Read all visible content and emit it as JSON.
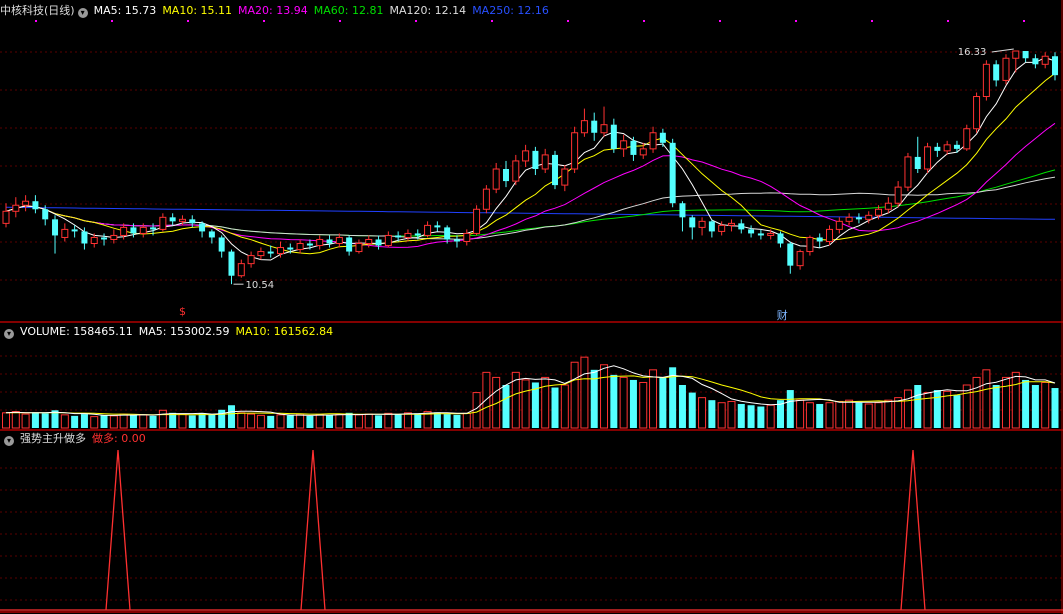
{
  "colors": {
    "up": "#ff3232",
    "down": "#54ffff",
    "ma5": "#ffffff",
    "ma10": "#ffff00",
    "ma20": "#ff00ff",
    "ma60": "#00e000",
    "ma120": "#d8d8d8",
    "ma250": "#2040ff",
    "divider": "#b00000",
    "grid": "#5a0000",
    "signal": "#ff3030",
    "marker": "#ff00ff"
  },
  "main_header": {
    "stock_name": "中核科技(日线)",
    "collapse_icon": "chevron-down-icon",
    "ma5_label": "MA5: 15.73",
    "ma10_label": "MA10: 15.11",
    "ma20_label": "MA20: 13.94",
    "ma60_label": "MA60: 12.81",
    "ma120_label": "MA120: 12.14",
    "ma250_label": "MA250: 12.16"
  },
  "volume_header": {
    "volume_label": "VOLUME: 158465.11",
    "ma5_label": "MA5: 153002.59",
    "ma10_label": "MA10: 161562.84"
  },
  "indicator_header": {
    "name": "强势主升做多",
    "signal_name": "做多",
    "signal_value": ": 0.00"
  },
  "annotations": {
    "high_label": "16.33",
    "low_label": "10.54",
    "mark_s": "$",
    "mark_cai": "财"
  },
  "chart_data": {
    "type": "candlestick",
    "price_range": [
      9.7,
      17.1
    ],
    "candles": [
      [
        12.05,
        12.35,
        12.55,
        11.95
      ],
      [
        12.35,
        12.5,
        12.7,
        12.2
      ],
      [
        12.5,
        12.6,
        12.75,
        12.35
      ],
      [
        12.6,
        12.4,
        12.75,
        12.3
      ],
      [
        12.4,
        12.15,
        12.5,
        12.0
      ],
      [
        12.15,
        11.75,
        12.25,
        11.3
      ],
      [
        11.7,
        11.9,
        12.05,
        11.6
      ],
      [
        11.9,
        11.85,
        12.0,
        11.7
      ],
      [
        11.85,
        11.55,
        11.95,
        11.4
      ],
      [
        11.55,
        11.7,
        11.8,
        11.45
      ],
      [
        11.7,
        11.65,
        11.8,
        11.5
      ],
      [
        11.65,
        11.75,
        11.9,
        11.55
      ],
      [
        11.75,
        11.95,
        12.05,
        11.65
      ],
      [
        11.95,
        11.8,
        12.05,
        11.7
      ],
      [
        11.8,
        11.95,
        12.05,
        11.7
      ],
      [
        11.95,
        11.9,
        12.05,
        11.75
      ],
      [
        11.9,
        12.2,
        12.3,
        11.85
      ],
      [
        12.2,
        12.1,
        12.3,
        12.0
      ],
      [
        12.1,
        12.15,
        12.25,
        12.0
      ],
      [
        12.15,
        12.05,
        12.25,
        11.95
      ],
      [
        12.05,
        11.85,
        12.1,
        11.7
      ],
      [
        11.85,
        11.7,
        11.9,
        11.55
      ],
      [
        11.7,
        11.35,
        11.75,
        11.2
      ],
      [
        11.35,
        10.75,
        11.4,
        10.54
      ],
      [
        10.75,
        11.05,
        11.15,
        10.7
      ],
      [
        11.05,
        11.25,
        11.35,
        10.95
      ],
      [
        11.25,
        11.35,
        11.45,
        11.15
      ],
      [
        11.35,
        11.3,
        11.5,
        11.2
      ],
      [
        11.3,
        11.45,
        11.6,
        11.2
      ],
      [
        11.45,
        11.4,
        11.55,
        11.3
      ],
      [
        11.4,
        11.55,
        11.65,
        11.3
      ],
      [
        11.55,
        11.5,
        11.65,
        11.4
      ],
      [
        11.5,
        11.65,
        11.75,
        11.4
      ],
      [
        11.65,
        11.55,
        11.75,
        11.45
      ],
      [
        11.55,
        11.7,
        11.8,
        11.45
      ],
      [
        11.7,
        11.35,
        11.75,
        11.25
      ],
      [
        11.35,
        11.55,
        11.65,
        11.3
      ],
      [
        11.55,
        11.65,
        11.75,
        11.45
      ],
      [
        11.65,
        11.5,
        11.75,
        11.4
      ],
      [
        11.5,
        11.75,
        11.85,
        11.45
      ],
      [
        11.75,
        11.7,
        11.85,
        11.6
      ],
      [
        11.7,
        11.8,
        11.9,
        11.6
      ],
      [
        11.8,
        11.75,
        11.9,
        11.65
      ],
      [
        11.75,
        12.0,
        12.1,
        11.7
      ],
      [
        12.0,
        11.95,
        12.1,
        11.85
      ],
      [
        11.95,
        11.65,
        12.0,
        11.55
      ],
      [
        11.65,
        11.6,
        11.75,
        11.45
      ],
      [
        11.6,
        11.8,
        11.9,
        11.5
      ],
      [
        11.8,
        12.4,
        12.5,
        11.75
      ],
      [
        12.4,
        12.9,
        13.0,
        12.3
      ],
      [
        12.9,
        13.4,
        13.55,
        12.8
      ],
      [
        13.4,
        13.1,
        13.6,
        12.95
      ],
      [
        13.1,
        13.6,
        13.75,
        13.0
      ],
      [
        13.6,
        13.85,
        14.0,
        13.45
      ],
      [
        13.85,
        13.4,
        13.95,
        13.25
      ],
      [
        13.4,
        13.75,
        13.9,
        13.3
      ],
      [
        13.75,
        13.0,
        13.85,
        12.9
      ],
      [
        13.0,
        13.4,
        13.5,
        12.85
      ],
      [
        13.4,
        14.3,
        14.45,
        13.3
      ],
      [
        14.3,
        14.6,
        14.9,
        14.2
      ],
      [
        14.6,
        14.3,
        14.8,
        14.1
      ],
      [
        14.3,
        14.5,
        14.95,
        14.2
      ],
      [
        14.5,
        13.9,
        14.65,
        13.8
      ],
      [
        13.9,
        14.1,
        14.25,
        13.7
      ],
      [
        14.1,
        13.75,
        14.2,
        13.6
      ],
      [
        13.75,
        13.9,
        14.05,
        13.65
      ],
      [
        13.9,
        14.3,
        14.45,
        13.8
      ],
      [
        14.3,
        14.05,
        14.4,
        13.95
      ],
      [
        14.05,
        12.55,
        14.15,
        12.45
      ],
      [
        12.55,
        12.2,
        12.6,
        11.85
      ],
      [
        12.2,
        11.95,
        12.25,
        11.65
      ],
      [
        11.95,
        12.1,
        12.2,
        11.75
      ],
      [
        12.1,
        11.85,
        12.15,
        11.7
      ],
      [
        11.85,
        12.0,
        12.1,
        11.75
      ],
      [
        12.0,
        12.05,
        12.15,
        11.85
      ],
      [
        12.05,
        11.9,
        12.15,
        11.8
      ],
      [
        11.9,
        11.8,
        12.0,
        11.7
      ],
      [
        11.8,
        11.75,
        11.9,
        11.65
      ],
      [
        11.75,
        11.8,
        11.9,
        11.65
      ],
      [
        11.8,
        11.55,
        11.85,
        11.45
      ],
      [
        11.55,
        11.0,
        11.6,
        10.8
      ],
      [
        11.0,
        11.35,
        11.4,
        10.9
      ],
      [
        11.35,
        11.7,
        11.75,
        11.25
      ],
      [
        11.7,
        11.6,
        11.8,
        11.45
      ],
      [
        11.6,
        11.9,
        12.0,
        11.5
      ],
      [
        11.9,
        12.1,
        12.2,
        11.8
      ],
      [
        12.1,
        12.2,
        12.3,
        12.0
      ],
      [
        12.2,
        12.15,
        12.3,
        12.05
      ],
      [
        12.15,
        12.25,
        12.35,
        12.05
      ],
      [
        12.25,
        12.4,
        12.5,
        12.15
      ],
      [
        12.4,
        12.55,
        12.7,
        12.3
      ],
      [
        12.55,
        12.95,
        13.1,
        12.45
      ],
      [
        12.95,
        13.7,
        13.8,
        12.85
      ],
      [
        13.7,
        13.4,
        14.2,
        13.3
      ],
      [
        13.4,
        13.95,
        14.05,
        13.3
      ],
      [
        13.95,
        13.85,
        14.05,
        13.7
      ],
      [
        13.85,
        14.0,
        14.1,
        13.75
      ],
      [
        14.0,
        13.9,
        14.1,
        13.8
      ],
      [
        13.9,
        14.4,
        14.5,
        13.85
      ],
      [
        14.4,
        15.2,
        15.3,
        14.3
      ],
      [
        15.2,
        16.0,
        16.1,
        15.1
      ],
      [
        16.0,
        15.6,
        16.1,
        15.45
      ],
      [
        15.6,
        16.15,
        16.25,
        15.5
      ],
      [
        16.15,
        16.33,
        16.33,
        15.8
      ],
      [
        16.33,
        16.15,
        16.3,
        16.05
      ],
      [
        16.15,
        16.0,
        16.25,
        15.9
      ],
      [
        16.0,
        16.2,
        16.3,
        15.9
      ],
      [
        16.2,
        15.73,
        16.3,
        15.6
      ]
    ],
    "volume_range": [
      0,
      340000
    ],
    "volume": [
      60,
      65,
      55,
      62,
      58,
      70,
      52,
      48,
      55,
      45,
      50,
      48,
      55,
      50,
      52,
      48,
      70,
      60,
      55,
      50,
      58,
      52,
      72,
      90,
      60,
      55,
      50,
      48,
      52,
      50,
      55,
      48,
      52,
      50,
      55,
      60,
      52,
      55,
      50,
      58,
      55,
      60,
      58,
      65,
      62,
      55,
      52,
      58,
      140,
      220,
      200,
      170,
      220,
      190,
      180,
      200,
      160,
      170,
      260,
      280,
      230,
      250,
      210,
      200,
      190,
      180,
      230,
      200,
      240,
      170,
      140,
      120,
      110,
      100,
      105,
      95,
      90,
      85,
      90,
      110,
      150,
      110,
      100,
      95,
      100,
      105,
      110,
      100,
      95,
      100,
      110,
      120,
      150,
      170,
      140,
      150,
      145,
      130,
      170,
      200,
      230,
      170,
      200,
      220,
      190,
      170,
      180,
      158
    ],
    "volume_ma5": [
      60,
      62,
      60,
      60,
      60,
      62,
      60,
      57,
      57,
      54,
      50,
      50,
      51,
      51,
      52,
      51,
      55,
      57,
      57,
      57,
      58,
      55,
      57,
      64,
      66,
      66,
      65,
      63,
      55,
      51,
      51,
      50,
      51,
      51,
      52,
      53,
      53,
      54,
      54,
      55,
      54,
      56,
      56,
      59,
      60,
      60,
      58,
      58,
      77,
      113,
      146,
      170,
      190,
      196,
      192,
      194,
      190,
      176,
      194,
      214,
      220,
      236,
      246,
      234,
      218,
      206,
      202,
      200,
      208,
      204,
      196,
      172,
      156,
      136,
      115,
      106,
      100,
      95,
      92,
      94,
      105,
      109,
      111,
      113,
      111,
      102,
      102,
      102,
      102,
      102,
      104,
      107,
      115,
      130,
      138,
      146,
      151,
      147,
      147,
      159,
      175,
      181,
      193,
      204,
      202,
      190,
      190,
      178
    ],
    "volume_ma10": [
      60,
      61,
      60,
      60,
      60,
      61,
      60,
      59,
      59,
      58,
      56,
      55,
      55,
      54,
      53,
      52,
      53,
      53,
      53,
      52,
      53,
      53,
      54,
      56,
      58,
      59,
      59,
      58,
      58,
      57,
      56,
      55,
      55,
      56,
      56,
      55,
      54,
      54,
      54,
      54,
      54,
      54,
      54,
      55,
      56,
      57,
      56,
      57,
      63,
      82,
      97,
      117,
      135,
      146,
      154,
      165,
      170,
      173,
      190,
      195,
      194,
      200,
      204,
      205,
      206,
      200,
      202,
      199,
      203,
      205,
      203,
      193,
      182,
      170,
      160,
      150,
      137,
      123,
      116,
      113,
      114,
      116,
      116,
      115,
      109,
      103,
      104,
      105,
      106,
      107,
      105,
      105,
      108,
      113,
      117,
      121,
      127,
      131,
      138,
      144,
      153,
      160,
      165,
      172,
      183,
      183,
      183,
      178
    ],
    "ma250_levels": [
      12.45,
      12.15
    ]
  }
}
